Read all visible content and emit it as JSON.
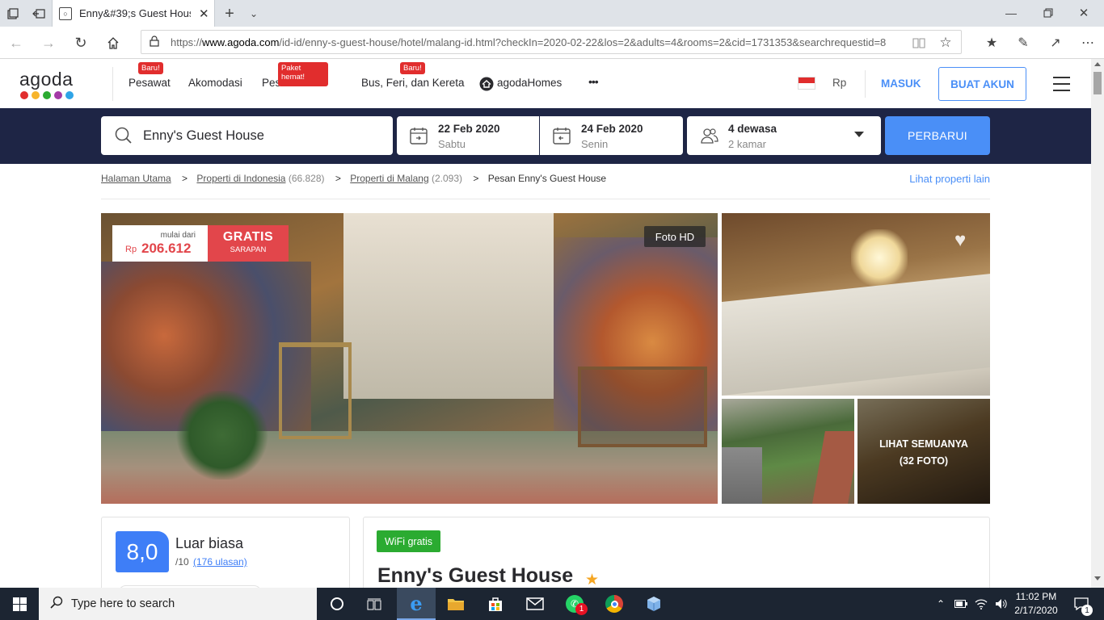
{
  "browser": {
    "tab_title": "Enny&#39;s Guest Hous",
    "url_prefix": "https://",
    "url_host": "www.agoda.com",
    "url_rest": "/id-id/enny-s-guest-house/hotel/malang-id.html?checkIn=2020-02-22&los=2&adults=4&rooms=2&cid=1731353&searchrequestid=8"
  },
  "nav": {
    "logo": "agoda",
    "items": [
      {
        "label": "Pesawat",
        "badge": "Baru!"
      },
      {
        "label": "Akomodasi",
        "badge": ""
      },
      {
        "label": "Pesan Hotel",
        "badge": "Paket hemat!"
      },
      {
        "label": "Bus, Feri, dan Kereta",
        "badge": "Baru!"
      },
      {
        "label": "agodaHomes",
        "badge": ""
      }
    ],
    "more": "•••",
    "currency": "Rp",
    "login": "MASUK",
    "signup": "BUAT AKUN"
  },
  "search": {
    "query": "Enny's Guest House",
    "checkin_date": "22 Feb 2020",
    "checkin_day": "Sabtu",
    "checkout_date": "24 Feb 2020",
    "checkout_day": "Senin",
    "guests": "4 dewasa",
    "rooms": "2 kamar",
    "button": "PERBARUI"
  },
  "breadcrumb": {
    "home": "Halaman Utama",
    "country": "Properti di Indonesia",
    "country_count": "(66.828)",
    "city": "Properti di Malang",
    "city_count": "(2.093)",
    "current": "Pesan Enny's Guest House",
    "more_link": "Lihat properti lain"
  },
  "gallery": {
    "price_from": "mulai dari",
    "price_currency": "Rp",
    "price_value": "206.612",
    "promo_title": "GRATIS",
    "promo_sub": "SARAPAN",
    "hd_label": "Foto HD",
    "see_all": "LIHAT SEMUANYA",
    "photo_count": "(32 FOTO)"
  },
  "review": {
    "score": "8,0",
    "label": "Luar biasa",
    "out_of": "/10",
    "reviews": "(176 ulasan)"
  },
  "hotel": {
    "amenity": "WiFi gratis",
    "name": "Enny's Guest House"
  },
  "taskbar": {
    "search_placeholder": "Type here to search",
    "time": "11:02 PM",
    "date": "2/17/2020",
    "whatsapp_badge": "1",
    "notif_badge": "1"
  },
  "colors": {
    "agoda_blue": "#4a8ff7",
    "nav_dark": "#1e2545",
    "promo_red": "#e2464b",
    "score_blue": "#3e7ef7",
    "wifi_green": "#2bab31"
  }
}
